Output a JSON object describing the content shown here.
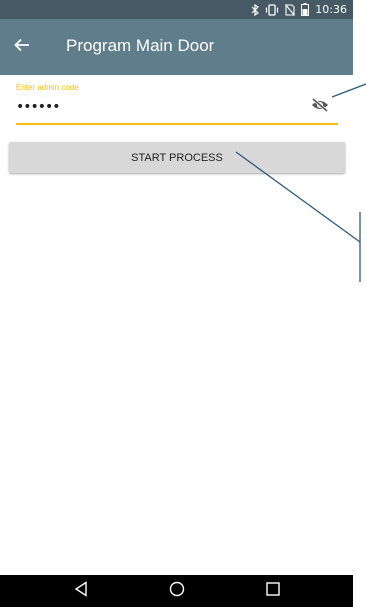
{
  "status_bar": {
    "time": "10:36",
    "icons": [
      "bluetooth-icon",
      "vibrate-icon",
      "no-sim-icon",
      "battery-icon"
    ],
    "background": "#455a64"
  },
  "app_bar": {
    "title": "Program Main Door",
    "back_icon": "arrow-back-icon",
    "background": "#607d8b"
  },
  "admin_code": {
    "label": "Enter admin code",
    "value": "••••••",
    "toggle_icon": "visibility-off-icon",
    "accent": "#f4c20d"
  },
  "start_button": {
    "label": "START PROCESS"
  },
  "nav_bar": {
    "items": [
      "back-triangle-icon",
      "home-circle-icon",
      "recents-square-icon"
    ]
  },
  "annotation_color": "#2e5a80"
}
